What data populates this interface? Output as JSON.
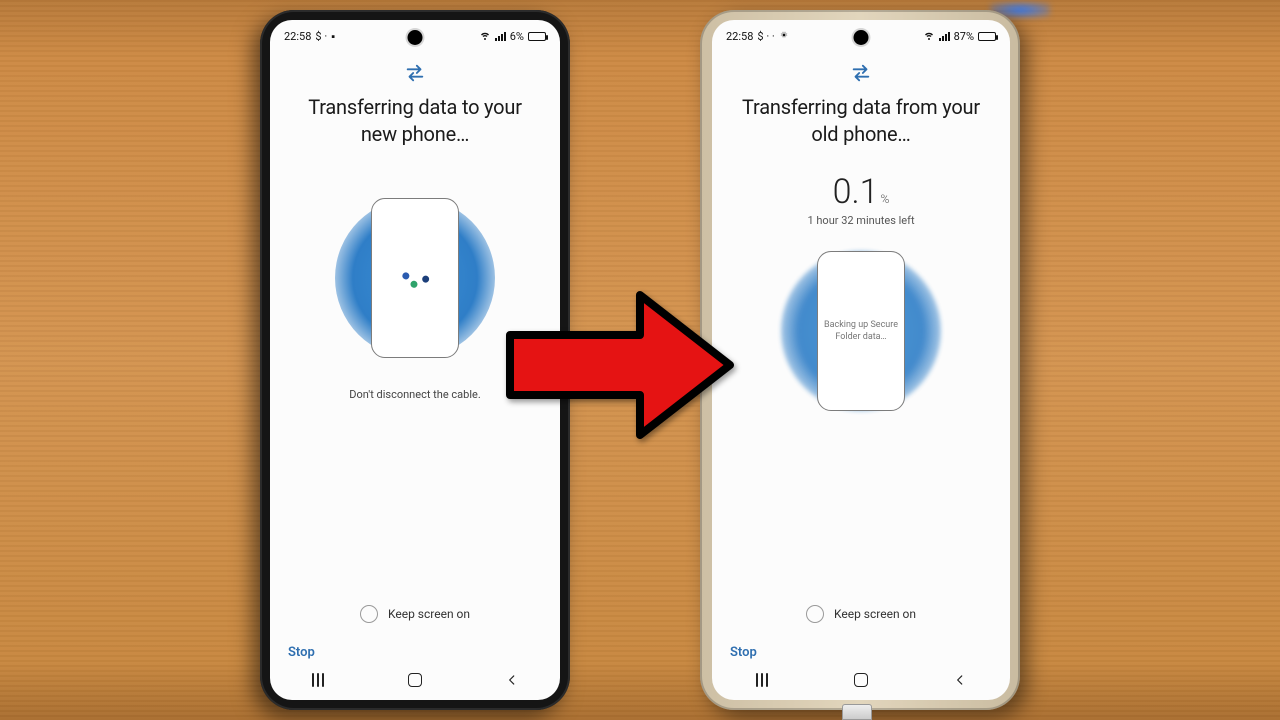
{
  "phoneLeft": {
    "status": {
      "time": "22:58",
      "leftExtras": "$ ·",
      "battery": "6%",
      "batteryFillPct": 6
    },
    "title": "Transferring data to your new phone…",
    "hint": "Don't disconnect the cable.",
    "keepScreen": "Keep screen on",
    "stop": "Stop"
  },
  "phoneRight": {
    "status": {
      "time": "22:58",
      "leftExtras": "$ · ·",
      "battery": "87%",
      "batteryFillPct": 87
    },
    "title": "Transferring data from your old phone…",
    "percent": "0.1",
    "percentUnit": "%",
    "eta": "1 hour 32 minutes left",
    "miniMessage": "Backing up Secure Folder data…",
    "keepScreen": "Keep screen on",
    "stop": "Stop"
  }
}
